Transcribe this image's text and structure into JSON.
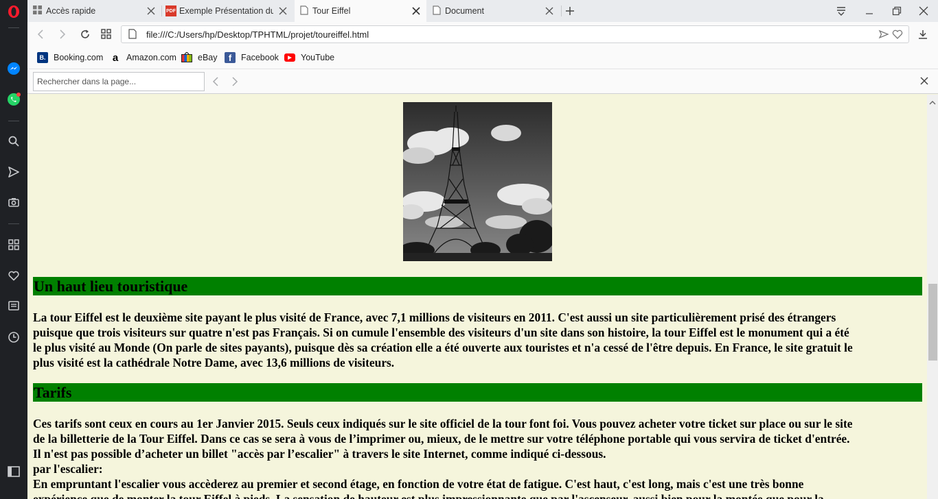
{
  "browser": {
    "tabs": [
      {
        "title": "Accès rapide",
        "icon": "grid-icon",
        "active": false
      },
      {
        "title": "Exemple Présentation du p",
        "icon": "pdf-icon",
        "active": false
      },
      {
        "title": "Tour Eiffel",
        "icon": "page-icon",
        "active": true
      },
      {
        "title": "Document",
        "icon": "page-icon",
        "active": false
      }
    ],
    "address": "file:///C:/Users/hp/Desktop/TPHTML/projet/toureiffel.html",
    "bookmarks": [
      {
        "label": "Booking.com",
        "icon": "booking-icon",
        "color": "#003580",
        "glyph": "B."
      },
      {
        "label": "Amazon.com",
        "icon": "amazon-icon",
        "color": "#000000",
        "glyph": "a"
      },
      {
        "label": "eBay",
        "icon": "ebay-icon",
        "color": "#e53238",
        "glyph": ""
      },
      {
        "label": "Facebook",
        "icon": "facebook-icon",
        "color": "#3b5998",
        "glyph": "f"
      },
      {
        "label": "YouTube",
        "icon": "youtube-icon",
        "color": "#ff0000",
        "glyph": "▶"
      }
    ],
    "find": {
      "placeholder": "Rechercher dans la page..."
    }
  },
  "content": {
    "section1": {
      "heading": "Un haut lieu touristique",
      "lines": [
        "La tour Eiffel est le deuxième site payant le plus visité de France, avec 7,1 millions de visiteurs en 2011. C'est aussi un site particulièrement prisé des étrangers",
        "puisque que trois visiteurs sur quatre n'est pas Français. Si on cumule l'ensemble des visiteurs d'un site dans son histoire, la tour Eiffel est le monument qui a été",
        "le plus visité au Monde (On parle de sites payants), puisque dès sa création elle a été ouverte aux touristes et n'a cessé de l'être depuis. En France, le site gratuit le",
        "plus visité est la cathédrale Notre Dame, avec 13,6 millions de visiteurs."
      ]
    },
    "section2": {
      "heading": "Tarifs",
      "lines": [
        "Ces tarifs sont ceux en cours au 1er Janvier 2015. Seuls ceux indiqués sur le site officiel de la tour font foi. Vous pouvez acheter votre ticket sur place ou sur le site",
        "de la billetterie de la Tour Eiffel. Dans ce cas se sera à vous de l’imprimer ou, mieux, de le mettre sur votre téléphone portable qui vous servira de ticket d'entrée.",
        "Il n'est pas possible d’acheter un billet \"accès par l’escalier\" à travers le site Internet, comme indiqué ci-dessous.",
        "par l'escalier:",
        "En empruntant l'escalier vous accèderez au premier et second étage, en fonction de votre état de fatigue. C'est haut, c'est long, mais c'est une très bonne",
        "expérience que de monter la tour Eiffel à pieds. La sensation de hauteur est plus impressionnante que par l'ascenseur, aussi bien pour la montée que pour la"
      ]
    }
  }
}
